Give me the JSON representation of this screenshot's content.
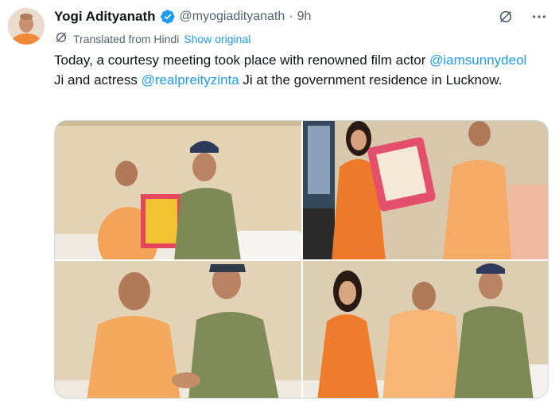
{
  "tweet": {
    "author_name": "Yogi Adityanath",
    "handle": "@myogiadityanath",
    "separator": "·",
    "time": "9h",
    "translated_label": "Translated from Hindi",
    "show_original": "Show original",
    "text_part1": "Today, a courtesy meeting took place with renowned film actor ",
    "mention1": "@iamsunnydeol",
    "text_part2": " Ji and actress ",
    "mention2": "@realpreityzinta",
    "text_part3": " Ji at the government residence in Lucknow."
  },
  "icons": {
    "verified": "verified-badge-icon",
    "grok": "grok-icon",
    "more": "more-options-icon",
    "translate": "translate-icon"
  },
  "colors": {
    "accent": "#1d9bf0",
    "muted": "#536471",
    "text": "#0f1419",
    "saffron": "#f39a4a",
    "olive": "#7a8a55"
  }
}
